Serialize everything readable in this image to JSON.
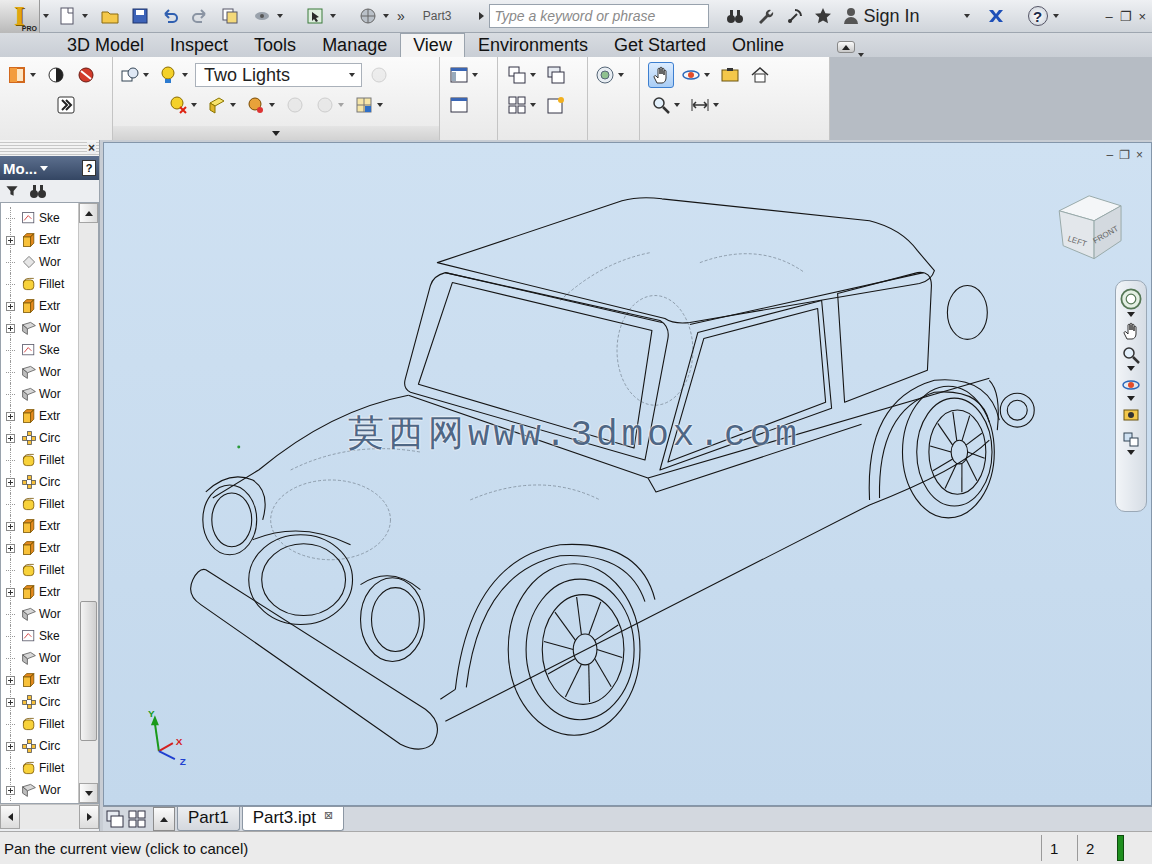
{
  "app": {
    "logo": "I",
    "edition": "PRO",
    "overflow": "»",
    "document_label": "Part3",
    "search": {
      "placeholder": "Type a keyword or phrase"
    },
    "sign_in": "Sign In",
    "help": "?",
    "window_controls": [
      "–",
      "❐",
      "×"
    ]
  },
  "ribbon": {
    "tabs": [
      {
        "label": "3D Model",
        "selected": false
      },
      {
        "label": "Inspect",
        "selected": false
      },
      {
        "label": "Tools",
        "selected": false
      },
      {
        "label": "Manage",
        "selected": false
      },
      {
        "label": "View",
        "selected": true
      },
      {
        "label": "Environments",
        "selected": false
      },
      {
        "label": "Get Started",
        "selected": false
      },
      {
        "label": "Online",
        "selected": false
      }
    ],
    "lighting": "Two Lights",
    "tools": [
      {
        "active": false,
        "disabled": false
      },
      {
        "active": false,
        "disabled": false
      },
      {
        "active": false,
        "disabled": false
      },
      {
        "active": false,
        "disabled": false
      },
      {
        "active": false,
        "disabled": false
      },
      {
        "active": false,
        "disabled": false
      },
      {
        "active": false,
        "disabled": true
      },
      {
        "active": false,
        "disabled": false
      },
      {
        "active": false,
        "disabled": false
      },
      {
        "active": false,
        "disabled": false
      },
      {
        "active": false,
        "disabled": true
      },
      {
        "active": false,
        "disabled": true
      },
      {
        "active": false,
        "disabled": false
      },
      {
        "active": false,
        "disabled": false
      },
      {
        "active": false,
        "disabled": false
      },
      {
        "active": false,
        "disabled": false
      },
      {
        "active": false,
        "disabled": false
      },
      {
        "active": false,
        "disabled": false
      },
      {
        "active": false,
        "disabled": false
      },
      {
        "active": false,
        "disabled": false
      },
      {
        "active": true,
        "disabled": false
      },
      {
        "active": false,
        "disabled": false
      },
      {
        "active": false,
        "disabled": false
      },
      {
        "active": false,
        "disabled": false
      },
      {
        "active": false,
        "disabled": false
      },
      {
        "active": false,
        "disabled": false
      }
    ]
  },
  "browser": {
    "title": "Mo...",
    "help": "?",
    "close": "×",
    "scroll_level": 0.9,
    "items": [
      {
        "label": "Ske",
        "kind": "sketch",
        "expandable": false
      },
      {
        "label": "Extr",
        "kind": "extrude",
        "expandable": true
      },
      {
        "label": "Wor",
        "kind": "workpoint",
        "expandable": false
      },
      {
        "label": "Fillet",
        "kind": "fillet",
        "expandable": false
      },
      {
        "label": "Extr",
        "kind": "extrude",
        "expandable": true
      },
      {
        "label": "Wor",
        "kind": "workplane",
        "expandable": true
      },
      {
        "label": "Ske",
        "kind": "sketch",
        "expandable": false
      },
      {
        "label": "Wor",
        "kind": "workplane",
        "expandable": false
      },
      {
        "label": "Wor",
        "kind": "workplane",
        "expandable": false
      },
      {
        "label": "Extr",
        "kind": "extrude",
        "expandable": true
      },
      {
        "label": "Circ",
        "kind": "pattern",
        "expandable": true
      },
      {
        "label": "Fillet",
        "kind": "fillet",
        "expandable": false
      },
      {
        "label": "Circ",
        "kind": "pattern",
        "expandable": true
      },
      {
        "label": "Fillet",
        "kind": "fillet",
        "expandable": false
      },
      {
        "label": "Extr",
        "kind": "extrude",
        "expandable": true
      },
      {
        "label": "Extr",
        "kind": "extrude",
        "expandable": true
      },
      {
        "label": "Fillet",
        "kind": "fillet",
        "expandable": false
      },
      {
        "label": "Extr",
        "kind": "extrude",
        "expandable": true
      },
      {
        "label": "Wor",
        "kind": "workplane",
        "expandable": false
      },
      {
        "label": "Ske",
        "kind": "sketch",
        "expandable": false
      },
      {
        "label": "Wor",
        "kind": "workplane",
        "expandable": false
      },
      {
        "label": "Extr",
        "kind": "extrude",
        "expandable": true
      },
      {
        "label": "Circ",
        "kind": "pattern",
        "expandable": true
      },
      {
        "label": "Fillet",
        "kind": "fillet",
        "expandable": false
      },
      {
        "label": "Circ",
        "kind": "pattern",
        "expandable": true
      },
      {
        "label": "Fillet",
        "kind": "fillet",
        "expandable": false
      },
      {
        "label": "Wor",
        "kind": "workplane",
        "expandable": true
      }
    ]
  },
  "viewport": {
    "watermark": "莫西网www.3dmox.com",
    "viewcube": {
      "left": "LEFT",
      "front": "FRONT"
    },
    "axes": {
      "x": "X",
      "y": "Y",
      "z": "Z"
    },
    "controls": [
      "–",
      "❐",
      "×"
    ]
  },
  "document_tabs": [
    {
      "label": "Part1",
      "selected": false,
      "close": ""
    },
    {
      "label": "Part3.ipt",
      "selected": true,
      "close": "⊠"
    }
  ],
  "status_bar": {
    "message": "Pan the current view (click to cancel)",
    "cells": [
      "1",
      "2"
    ]
  }
}
